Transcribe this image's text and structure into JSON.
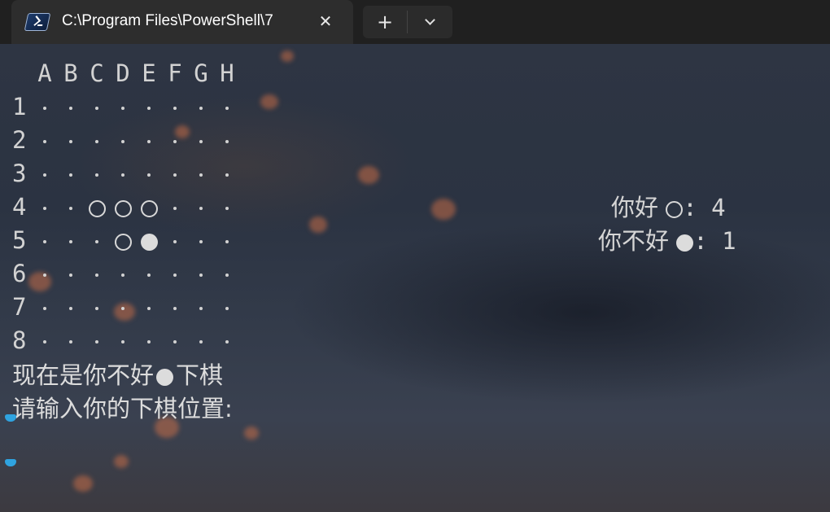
{
  "tab": {
    "title": "C:\\Program Files\\PowerShell\\7",
    "close_icon": "close-icon",
    "app_icon": "powershell-icon"
  },
  "toolbar": {
    "new_tab_label": "+",
    "dropdown_icon": "chevron-down-icon"
  },
  "board": {
    "columns": [
      "A",
      "B",
      "C",
      "D",
      "E",
      "F",
      "G",
      "H"
    ],
    "rows": [
      {
        "label": "1",
        "cells": [
          ".",
          ".",
          ".",
          ".",
          ".",
          ".",
          ".",
          "."
        ]
      },
      {
        "label": "2",
        "cells": [
          ".",
          ".",
          ".",
          ".",
          ".",
          ".",
          ".",
          "."
        ]
      },
      {
        "label": "3",
        "cells": [
          ".",
          ".",
          ".",
          ".",
          ".",
          ".",
          ".",
          "."
        ]
      },
      {
        "label": "4",
        "cells": [
          ".",
          ".",
          "o",
          "o",
          "o",
          ".",
          ".",
          "."
        ]
      },
      {
        "label": "5",
        "cells": [
          ".",
          ".",
          ".",
          "o",
          "x",
          ".",
          ".",
          "."
        ]
      },
      {
        "label": "6",
        "cells": [
          ".",
          ".",
          ".",
          ".",
          ".",
          ".",
          ".",
          "."
        ]
      },
      {
        "label": "7",
        "cells": [
          ".",
          ".",
          ".",
          ".",
          ".",
          ".",
          ".",
          "."
        ]
      },
      {
        "label": "8",
        "cells": [
          ".",
          ".",
          ".",
          ".",
          ".",
          ".",
          ".",
          "."
        ]
      }
    ]
  },
  "score": {
    "player1_name": "你好",
    "player1_count": "4",
    "player2_name": "你不好",
    "player2_count": "1",
    "separator": ":"
  },
  "messages": {
    "turn_prefix": "现在是你不好",
    "turn_suffix": "下棋",
    "prompt": "请输入你的下棋位置:"
  },
  "colors": {
    "stone": "#dcdcdc",
    "cursor": "#2fa3e0",
    "tab_bg": "#2d2d2d"
  }
}
